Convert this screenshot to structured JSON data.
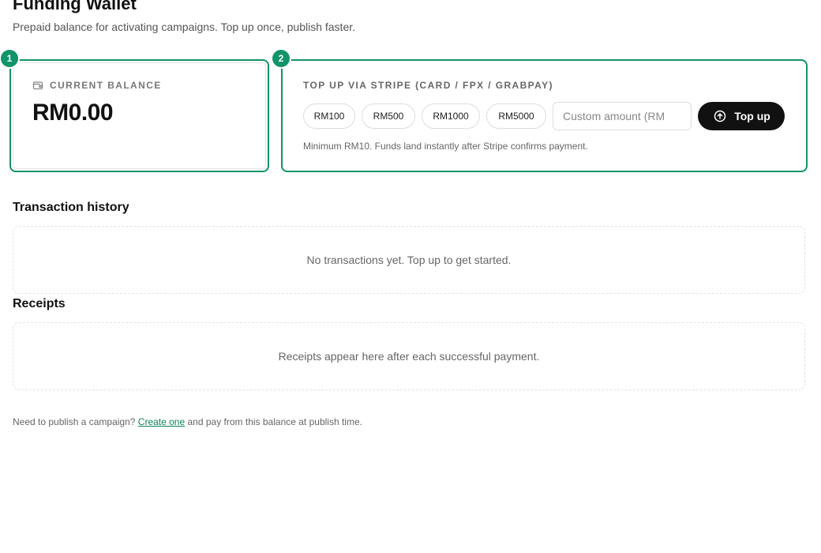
{
  "header": {
    "title": "Funding Wallet",
    "subtitle": "Prepaid balance for activating campaigns. Top up once, publish faster."
  },
  "steps": [
    "1",
    "2"
  ],
  "balance_card": {
    "label": "CURRENT BALANCE",
    "icon": "wallet-icon",
    "value": "RM0.00"
  },
  "topup_card": {
    "label": "TOP UP VIA STRIPE (CARD / FPX / GRABPAY)",
    "presets": [
      "RM100",
      "RM500",
      "RM1000",
      "RM5000"
    ],
    "custom_amount": {
      "value": "",
      "placeholder": "Custom amount (RM"
    },
    "button_label": "Top up",
    "button_icon": "arrow-up-circle-icon",
    "hint": "Minimum RM10. Funds land instantly after Stripe confirms payment."
  },
  "transactions": {
    "heading": "Transaction history",
    "empty_text": "No transactions yet. Top up to get started."
  },
  "receipts": {
    "heading": "Receipts",
    "empty_text": "Receipts appear here after each successful payment."
  },
  "footer": {
    "text_before": "Need to publish a campaign?",
    "link": "Create one",
    "text_after": "and pay from this balance at publish time."
  },
  "colors": {
    "accent": "#12936a",
    "button_bg": "#111111",
    "link": "#12805d"
  }
}
